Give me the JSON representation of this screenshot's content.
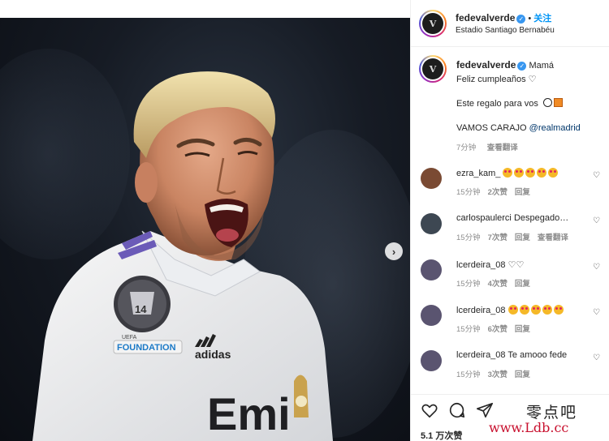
{
  "post": {
    "username": "fedevalverde",
    "location": "Estadio Santiago Bernabéu",
    "follow_label": "关注",
    "dot": "•",
    "avatar_initial": "V",
    "jersey_text": "Emi",
    "badge_number": "14",
    "foundation_label": "FOUNDATION",
    "uefa_label": "UEFA",
    "sponsor": "adidas"
  },
  "caption": {
    "username": "fedevalverde",
    "line1": "Mamá",
    "line2": "Feliz cumpleaños ♡",
    "line3": "Este regalo para vos",
    "line4_prefix": "VAMOS CARAJO ",
    "mention": "@realmadrid",
    "time": "7分钟",
    "translate": "查看翻译"
  },
  "comments": [
    {
      "user": "ezra_kam_",
      "text": "",
      "emoji_count": 5,
      "time": "15分钟",
      "likes": "2次赞",
      "reply": "回复",
      "translate": "",
      "avatar_color": "#7a4a33"
    },
    {
      "user": "carlospaulerci",
      "text": "Despegado…",
      "emoji_count": 0,
      "time": "15分钟",
      "likes": "7次赞",
      "reply": "回复",
      "translate": "查看翻译",
      "avatar_color": "#3d4752"
    },
    {
      "user": "lcerdeira_08",
      "text": "♡♡",
      "emoji_count": 0,
      "time": "15分钟",
      "likes": "4次赞",
      "reply": "回复",
      "translate": "",
      "avatar_color": "#5a5470"
    },
    {
      "user": "lcerdeira_08",
      "text": "",
      "emoji_count": 5,
      "time": "15分钟",
      "likes": "6次赞",
      "reply": "回复",
      "translate": "",
      "avatar_color": "#5a5470"
    },
    {
      "user": "lcerdeira_08",
      "text": "Te amooo fede",
      "emoji_count": 0,
      "time": "15分钟",
      "likes": "3次赞",
      "reply": "回复",
      "translate": "",
      "avatar_color": "#5a5470"
    }
  ],
  "footer": {
    "likes": "5.1 万次赞"
  },
  "watermark": {
    "cn": "零点吧",
    "url": "www.Ldb.cc"
  },
  "colors": {
    "accent": "#0095f6",
    "verified": "#3897f0",
    "watermark_red": "#c8102e"
  },
  "icons": [
    "heart-icon",
    "comment-icon",
    "share-icon",
    "verified-icon",
    "next-arrow-icon"
  ]
}
